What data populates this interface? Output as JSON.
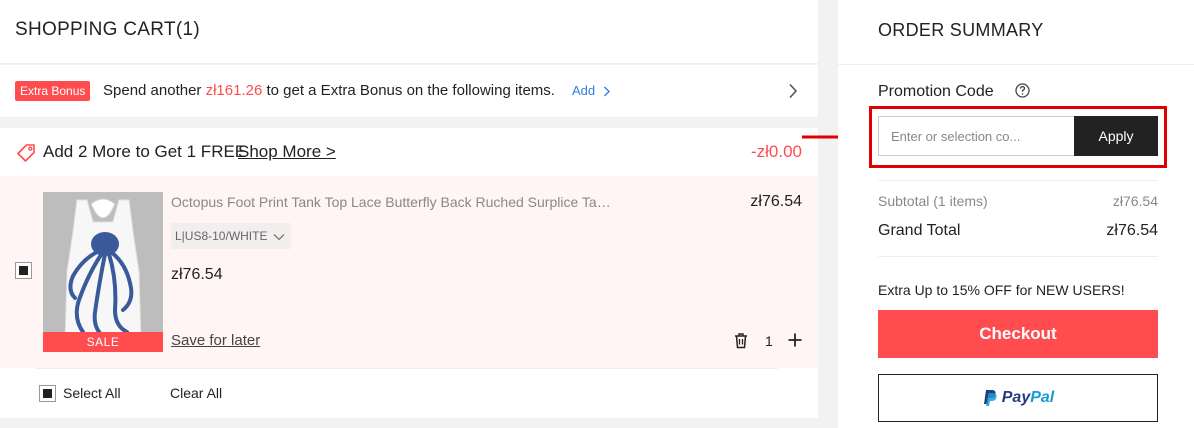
{
  "cart": {
    "title": "SHOPPING CART(1)"
  },
  "bonus": {
    "badge": "Extra Bonus",
    "text_before": "Spend another ",
    "amount": "zł161.26",
    "text_after": " to get a Extra Bonus on the following items.",
    "add_label": "Add"
  },
  "promo": {
    "text": "Add 2 More to Get 1 FREE",
    "shop_more": "Shop More >",
    "discount": "-zł0.00"
  },
  "item": {
    "title": "Octopus Foot Print Tank Top Lace Butterfly Back Ruched Surplice Tank Top",
    "variant": "L|US8-10/WHITE",
    "price": "zł76.54",
    "price_right": "zł76.54",
    "sale_tag": "SALE",
    "save_later": "Save for later",
    "quantity": "1"
  },
  "footer": {
    "select_all": "Select All",
    "clear_all": "Clear All"
  },
  "summary": {
    "title": "ORDER SUMMARY",
    "promo_label": "Promotion Code",
    "promo_placeholder": "Enter or selection co...",
    "apply_label": "Apply",
    "subtotal_label": "Subtotal (1 items)",
    "subtotal_value": "zł76.54",
    "grand_total_label": "Grand Total",
    "grand_total_value": "zł76.54",
    "extra_offer": "Extra Up to 15% OFF for NEW USERS!",
    "checkout_label": "Checkout",
    "paypal_pay": "Pay",
    "paypal_pal": "Pal"
  },
  "colors": {
    "accent_red": "#ff4d4f",
    "link_blue": "#2f7fe0",
    "highlight_red": "#e00000",
    "paypal_dark": "#253b80",
    "paypal_light": "#179bd7"
  },
  "icons": {
    "bonus_chevron": "chevron-right-icon",
    "promo": "tag-icon",
    "variant": "chevron-down-icon",
    "delete": "trash-icon",
    "increase": "plus-icon",
    "help": "question-circle-icon",
    "paypal": "paypal-logo-icon"
  }
}
